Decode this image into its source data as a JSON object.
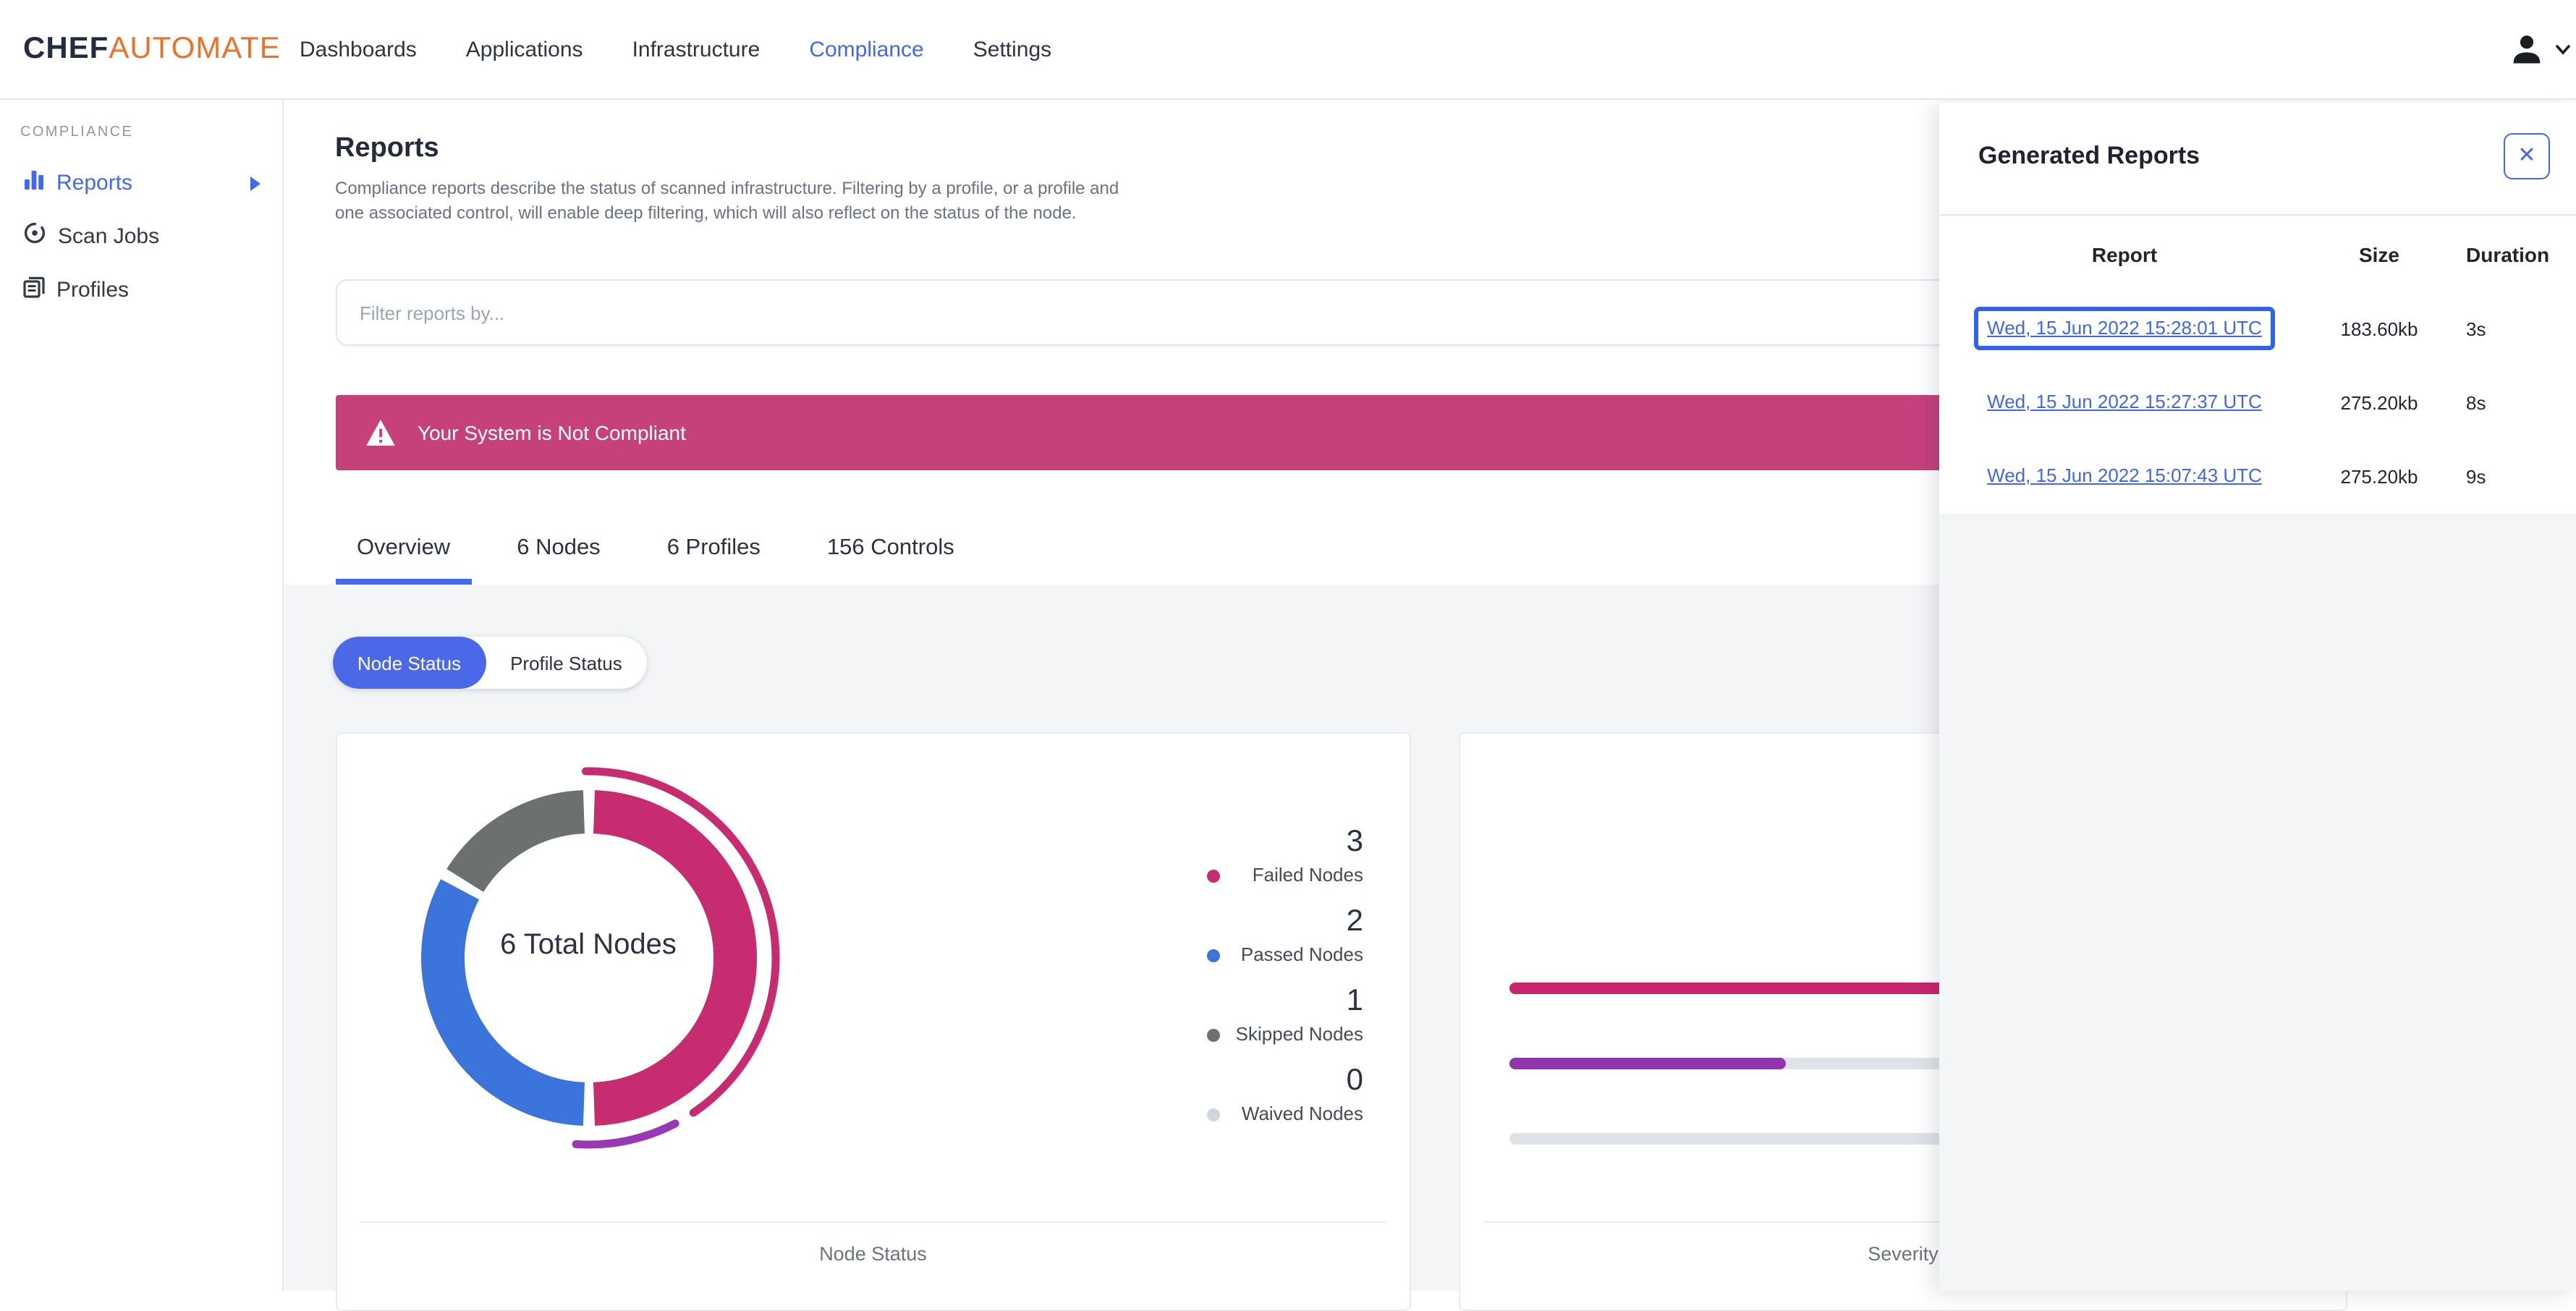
{
  "header": {
    "brand": {
      "chef": "CHEF",
      "automate": "AUTOMATE",
      "chef_color": "#232C41",
      "automate_color": "#EF7124"
    },
    "nav": [
      {
        "label": "Dashboards",
        "active": false
      },
      {
        "label": "Applications",
        "active": false
      },
      {
        "label": "Infrastructure",
        "active": false
      },
      {
        "label": "Compliance",
        "active": true
      },
      {
        "label": "Settings",
        "active": false
      }
    ],
    "active_color": "#4169F0"
  },
  "sidebar": {
    "section_label": "COMPLIANCE",
    "items": [
      {
        "label": "Reports",
        "icon": "bar-chart-icon",
        "active": true,
        "has_submenu": true
      },
      {
        "label": "Scan Jobs",
        "icon": "scan-target-icon",
        "active": false,
        "has_submenu": false
      },
      {
        "label": "Profiles",
        "icon": "profiles-icon",
        "active": false,
        "has_submenu": false
      }
    ]
  },
  "main": {
    "title": "Reports",
    "description": "Compliance reports describe the status of scanned infrastructure. Filtering by a profile, or a profile and\none associated control, will enable deep filtering, which will also reflect on the status of the node.",
    "filter_placeholder": "Filter reports by...",
    "alert": {
      "icon": "warning-triangle-icon",
      "text": "Your System is Not Compliant",
      "color": "#C6407C"
    },
    "tabs": [
      {
        "label": "Overview",
        "active": true
      },
      {
        "label": "6 Nodes",
        "active": false
      },
      {
        "label": "6 Profiles",
        "active": false
      },
      {
        "label": "156 Controls",
        "active": false
      }
    ],
    "status_toggle": [
      {
        "label": "Node Status",
        "active": true
      },
      {
        "label": "Profile Status",
        "active": false
      }
    ]
  },
  "chart_data": [
    {
      "type": "donut",
      "title": "Node Status",
      "center_label": "6 Total Nodes",
      "total": 6,
      "segments": [
        {
          "label": "Failed Nodes",
          "value": 3,
          "color": "#C72B70"
        },
        {
          "label": "Passed Nodes",
          "value": 2,
          "color": "#3B74DB"
        },
        {
          "label": "Skipped Nodes",
          "value": 1,
          "color": "#6C7170"
        },
        {
          "label": "Waived Nodes",
          "value": 0,
          "color": "#CFD7DC"
        }
      ],
      "outer_ring_arcs": [
        {
          "color": "#C72B70",
          "start_deg": -1,
          "end_deg": 146
        },
        {
          "color": "#9A37B4",
          "start_deg": 152.5,
          "end_deg": 184
        }
      ],
      "legend_position": "right"
    },
    {
      "type": "bar",
      "title": "Severity",
      "orientation": "horizontal",
      "values_pct": [
        100,
        35,
        0
      ],
      "bar_colors": [
        "#C7266C",
        "#9334AF",
        "#DFE3E7"
      ],
      "track_color": "#DFE3E7"
    }
  ],
  "reports_panel": {
    "title": "Generated Reports",
    "close_icon": "close-icon",
    "columns": [
      "Report",
      "Size",
      "Duration"
    ],
    "rows": [
      {
        "report": "Wed, 15 Jun 2022 15:28:01 UTC",
        "size": "183.60kb",
        "duration": "3s",
        "selected": true
      },
      {
        "report": "Wed, 15 Jun 2022 15:27:37 UTC",
        "size": "275.20kb",
        "duration": "8s",
        "selected": false
      },
      {
        "report": "Wed, 15 Jun 2022 15:07:43 UTC",
        "size": "275.20kb",
        "duration": "9s",
        "selected": false
      }
    ]
  },
  "colors": {
    "accent_blue": "#4269F1",
    "link_blue": "#4067E9",
    "selected_outline": "#2E63EE",
    "banner_pink": "#C6407C",
    "failed_pink": "#C72B70",
    "passed_blue": "#3B74DB",
    "skipped_gray": "#6C7170",
    "waived_gray": "#CFD7DC",
    "severity_purple": "#9334AF",
    "page_gray": "#F3F5F7"
  }
}
